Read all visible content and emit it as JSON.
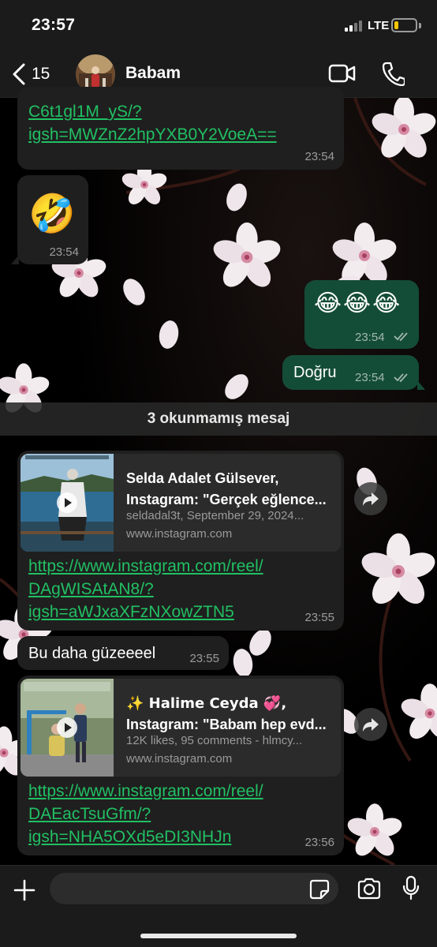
{
  "status_bar": {
    "time": "23:57",
    "network": "LTE",
    "battery_level": 0.2,
    "colors": {
      "battery": "#f5c400"
    }
  },
  "header": {
    "back_count": "15",
    "contact_name": "Babam",
    "icons": [
      "chevron-left-icon",
      "video-camera-icon",
      "phone-icon"
    ]
  },
  "messages": [
    {
      "direction": "in",
      "link_lines": [
        "C6t1gl1M_yS/?",
        "igsh=MWZnZ2hpYXB0Y2VoeA=="
      ],
      "time": "23:54"
    },
    {
      "direction": "in",
      "emoji": "🤣",
      "time": "23:54"
    },
    {
      "direction": "out",
      "emoji": "😂😂😂",
      "time": "23:54",
      "status": "read"
    },
    {
      "direction": "out",
      "text": "Doğru",
      "time": "23:54",
      "status": "read"
    }
  ],
  "unread_banner": "3 okunmamış mesaj",
  "unread_messages": [
    {
      "direction": "in",
      "preview": {
        "title_lines": [
          "Selda Adalet Gülsever,",
          "Instagram: \"Gerçek eğlence..."
        ],
        "meta": "seldadal3t, September 29, 2024...",
        "domain": "www.instagram.com"
      },
      "link_lines": [
        "https://www.instagram.com/reel/",
        "DAgWISAtAN8/?",
        "igsh=aWJxaXFzNXowZTN5"
      ],
      "time": "23:55"
    },
    {
      "direction": "in",
      "text": "Bu daha güzeeeel",
      "time": "23:55"
    },
    {
      "direction": "in",
      "preview": {
        "title_lines": [
          "✨ Halime Ceyda 💞,",
          "Instagram: \"Babam hep evd..."
        ],
        "meta": "12K likes, 95 comments - hlmcy...",
        "domain": "www.instagram.com"
      },
      "link_lines": [
        "https://www.instagram.com/reel/",
        "DAEacTsuGfm/?",
        "igsh=NHA5OXd5eDI3NHJn"
      ],
      "time": "23:56"
    }
  ],
  "composer": {
    "placeholder": "",
    "icons": [
      "plus-icon",
      "sticker-icon",
      "camera-icon",
      "microphone-icon"
    ]
  },
  "colors": {
    "incoming_bubble": "#1f1f1f",
    "outgoing_bubble": "#144d37",
    "link": "#21c063",
    "header_bg": "#1b1b1b"
  }
}
